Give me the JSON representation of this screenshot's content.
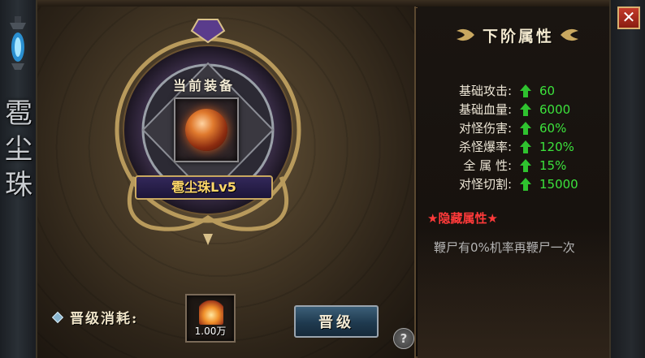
{
  "side": {
    "title_chars": [
      "雹",
      "尘",
      "珠"
    ]
  },
  "equip": {
    "current_label": "当前装备",
    "item_name": "雹尘珠Lv5",
    "item_icon": "fire-orb-icon"
  },
  "cost": {
    "label": "晋级消耗:",
    "amount": "1.00万",
    "icon": "ember-crystal-icon"
  },
  "buttons": {
    "upgrade": "晋级",
    "help": "?",
    "close": "✕"
  },
  "next_attrs": {
    "title": "下阶属性",
    "rows": [
      {
        "name": "基础攻击:",
        "value": "60"
      },
      {
        "name": "基础血量:",
        "value": "6000"
      },
      {
        "name": "对怪伤害:",
        "value": "60%"
      },
      {
        "name": "杀怪爆率:",
        "value": "120%"
      },
      {
        "name": "全 属 性:",
        "value": "15%"
      },
      {
        "name": "对怪切割:",
        "value": "15000"
      }
    ]
  },
  "hidden": {
    "title": "★隐藏属性★",
    "desc": "鞭尸有0%机率再鞭尸一次"
  },
  "colors": {
    "value_green": "#3ce23c",
    "hidden_red": "#ff3a3a",
    "name_gold": "#ffd86a"
  }
}
